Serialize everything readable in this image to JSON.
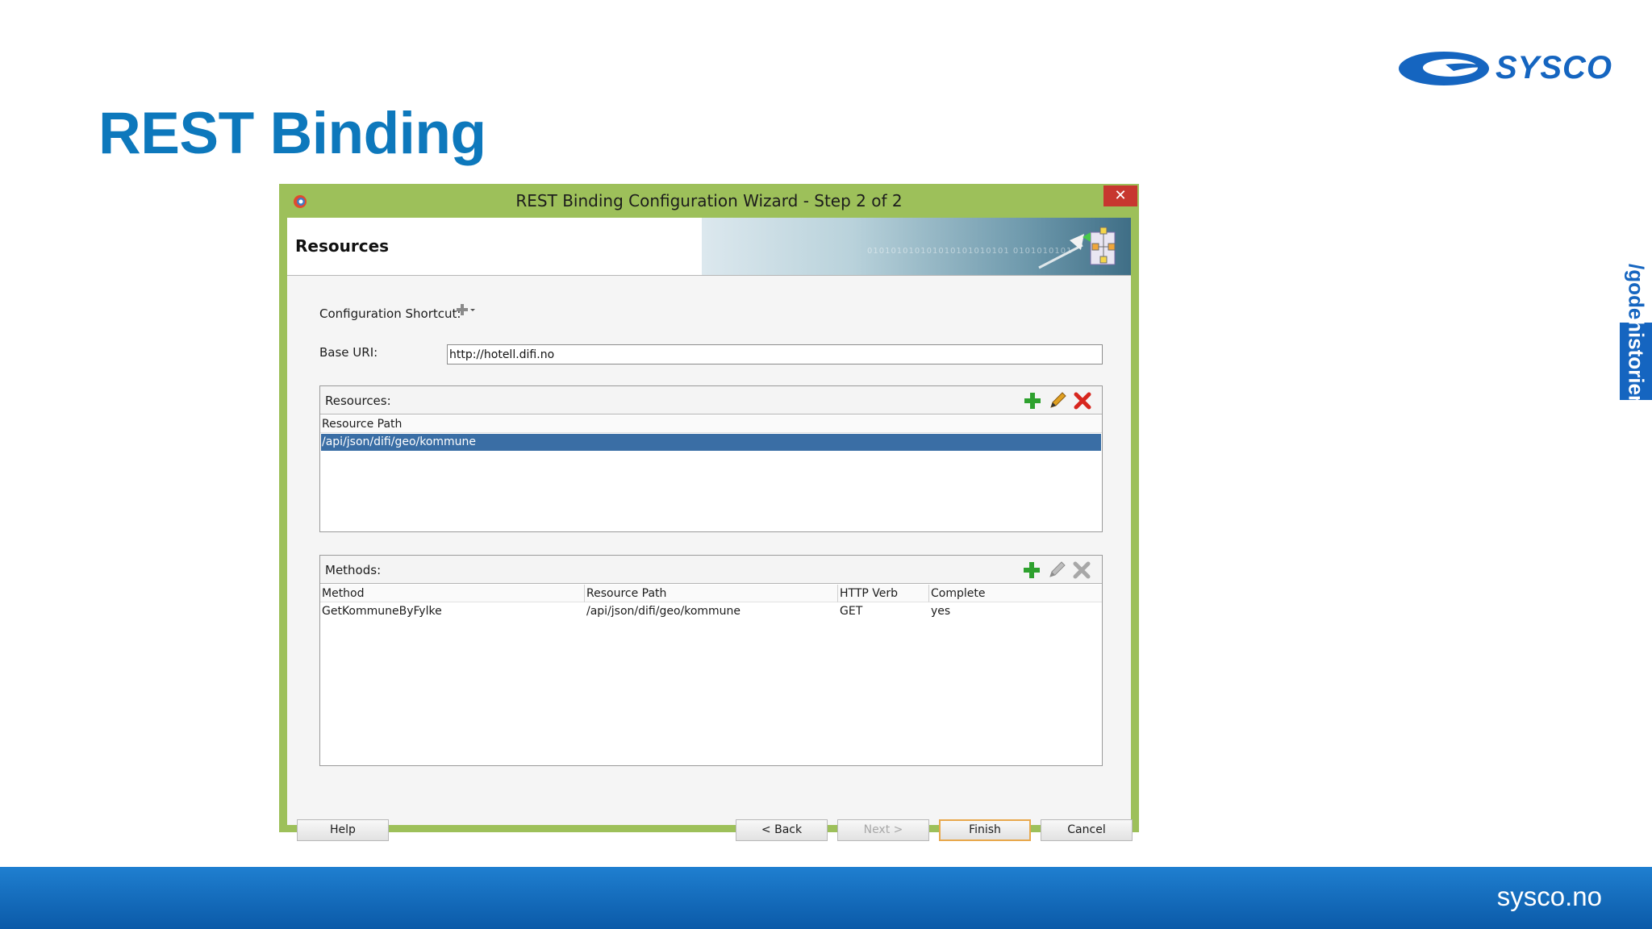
{
  "slide": {
    "title": "REST Binding",
    "logo_text": "SYSCO",
    "side_tab_top": "/gode",
    "side_tab_bottom": "historier",
    "footer_text": "sysco.no"
  },
  "window": {
    "title": "REST Binding Configuration Wizard - Step 2 of 2",
    "close_label": "✕",
    "header_title": "Resources",
    "header_binary": "010101010101010101010101 0101010101"
  },
  "form": {
    "shortcut_label": "Configuration Shortcut:",
    "base_uri_label": "Base URI:",
    "base_uri_value": "http://hotell.difi.no"
  },
  "resources": {
    "label": "Resources:",
    "column": "Resource Path",
    "selected_row": "/api/json/difi/geo/kommune"
  },
  "methods": {
    "label": "Methods:",
    "columns": [
      "Method",
      "Resource Path",
      "HTTP Verb",
      "Complete"
    ],
    "rows": [
      [
        "GetKommuneByFylke",
        "/api/json/difi/geo/kommune",
        "GET",
        "yes"
      ]
    ]
  },
  "buttons": {
    "help": "Help",
    "back": "< Back",
    "next": "Next >",
    "finish": "Finish",
    "cancel": "Cancel"
  },
  "icons": {
    "add": "plus-icon",
    "edit": "pencil-icon",
    "delete": "delete-x-icon",
    "shortcut": "add-dropdown-icon"
  },
  "colors": {
    "title_blue": "#0d78bc",
    "window_frame": "#9dc05a",
    "selection": "#3a6ea5",
    "footer": "#0b5aa8",
    "close_button": "#c7372f"
  }
}
